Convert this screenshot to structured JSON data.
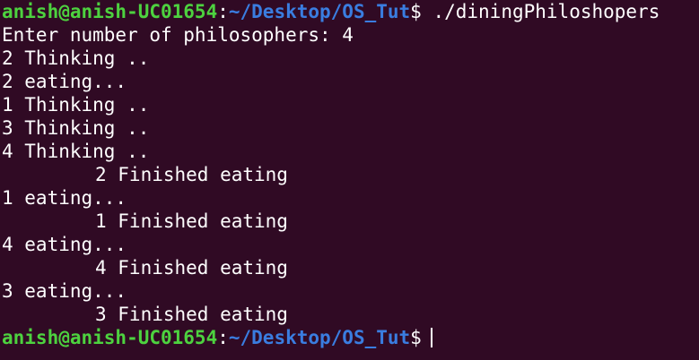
{
  "prompt": {
    "user_host": "anish@anish-UC01654",
    "colon": ":",
    "path": "~/Desktop/OS_Tut",
    "dollar": "$",
    "command": " ./diningPhiloshopers"
  },
  "output": {
    "l1": "Enter number of philosophers: 4",
    "l2": "2 Thinking ..",
    "l3": "2 eating...",
    "l4": "1 Thinking ..",
    "l5": "3 Thinking ..",
    "l6": "4 Thinking ..",
    "l7": "2 Finished eating",
    "l8": "1 eating...",
    "l9": "1 Finished eating",
    "l10": "4 eating...",
    "l11": "4 Finished eating",
    "l12": "3 eating...",
    "l13": "3 Finished eating"
  },
  "colors": {
    "background": "#300a24",
    "user_host": "#4dd23f",
    "path": "#3a7de0",
    "text": "#ffffff"
  }
}
